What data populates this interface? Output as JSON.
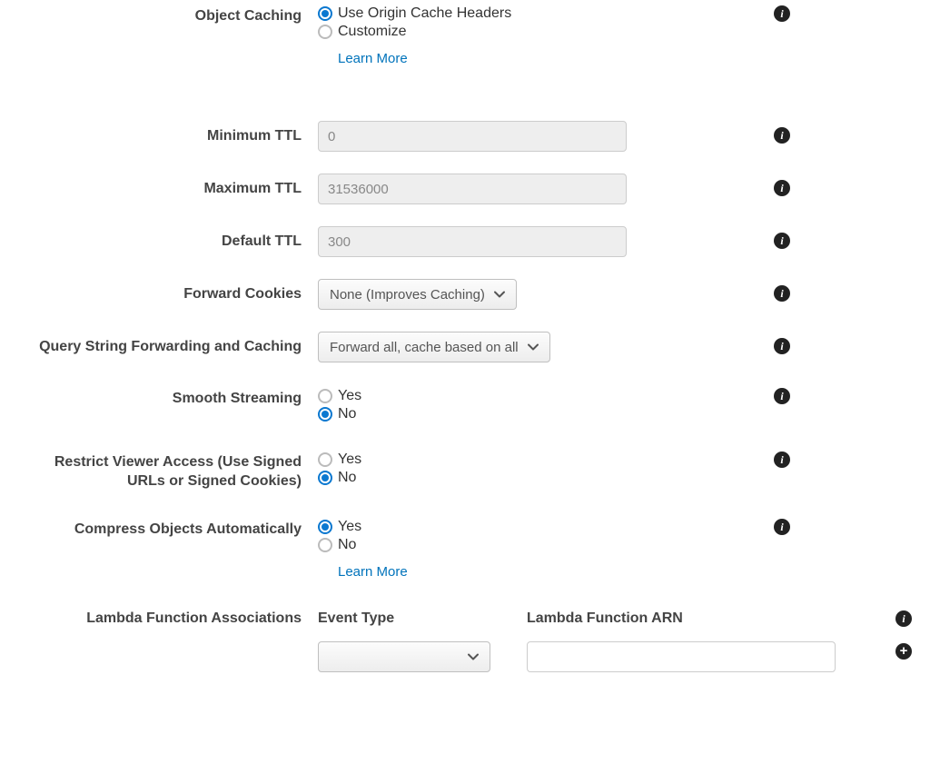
{
  "objectCaching": {
    "label": "Object Caching",
    "option1": "Use Origin Cache Headers",
    "option2": "Customize",
    "learnMore": "Learn More"
  },
  "minTTL": {
    "label": "Minimum TTL",
    "value": "0"
  },
  "maxTTL": {
    "label": "Maximum TTL",
    "value": "31536000"
  },
  "defaultTTL": {
    "label": "Default TTL",
    "value": "300"
  },
  "forwardCookies": {
    "label": "Forward Cookies",
    "value": "None (Improves Caching)"
  },
  "queryString": {
    "label": "Query String Forwarding and Caching",
    "value": "Forward all, cache based on all"
  },
  "smoothStreaming": {
    "label": "Smooth Streaming",
    "yes": "Yes",
    "no": "No"
  },
  "restrictViewer": {
    "label": "Restrict Viewer Access (Use Signed URLs or Signed Cookies)",
    "yes": "Yes",
    "no": "No"
  },
  "compress": {
    "label": "Compress Objects Automatically",
    "yes": "Yes",
    "no": "No",
    "learnMore": "Learn More"
  },
  "lambda": {
    "label": "Lambda Function Associations",
    "eventTypeHeader": "Event Type",
    "arnHeader": "Lambda Function ARN"
  }
}
